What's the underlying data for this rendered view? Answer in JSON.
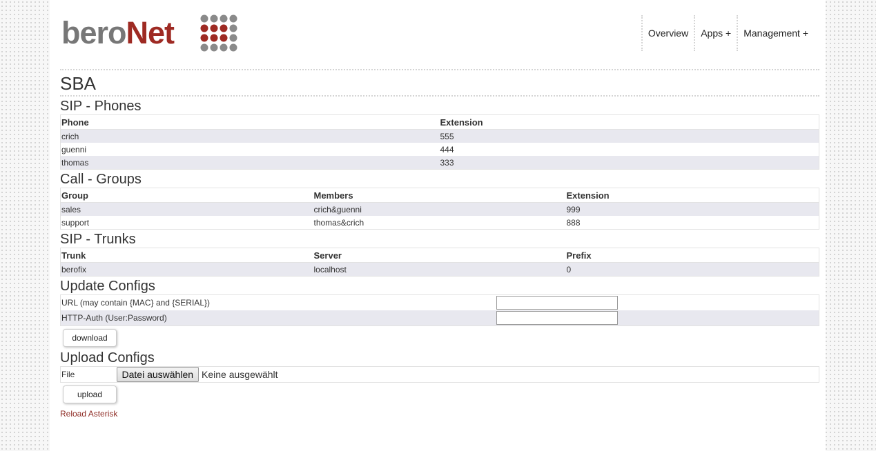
{
  "logo": {
    "part1": "bero",
    "part2": "Net"
  },
  "nav": {
    "items": [
      "Overview",
      "Apps +",
      "Management +"
    ]
  },
  "page_title": "SBA",
  "sip_phones": {
    "heading": "SIP - Phones",
    "columns": [
      "Phone",
      "Extension"
    ],
    "rows": [
      [
        "crich",
        "555"
      ],
      [
        "guenni",
        "444"
      ],
      [
        "thomas",
        "333"
      ]
    ]
  },
  "call_groups": {
    "heading": "Call - Groups",
    "columns": [
      "Group",
      "Members",
      "Extension"
    ],
    "rows": [
      [
        "sales",
        "crich&guenni",
        "999"
      ],
      [
        "support",
        "thomas&crich",
        "888"
      ]
    ]
  },
  "sip_trunks": {
    "heading": "SIP - Trunks",
    "columns": [
      "Trunk",
      "Server",
      "Prefix"
    ],
    "rows": [
      [
        "berofix",
        "localhost",
        "0"
      ]
    ]
  },
  "update_configs": {
    "heading": "Update Configs",
    "url_label": "URL (may contain {MAC} and {SERIAL})",
    "url_value": "",
    "auth_label": "HTTP-Auth (User:Password)",
    "auth_value": "",
    "download_label": "download"
  },
  "upload_configs": {
    "heading": "Upload Configs",
    "file_label": "File",
    "choose_label": "Datei auswählen",
    "no_file": "Keine ausgewählt",
    "upload_label": "upload"
  },
  "reload_link": "Reload Asterisk",
  "colors": {
    "brand_red": "#9e2a23",
    "logo_gray": "#777777",
    "row_stripe": "#e8e8ef"
  }
}
